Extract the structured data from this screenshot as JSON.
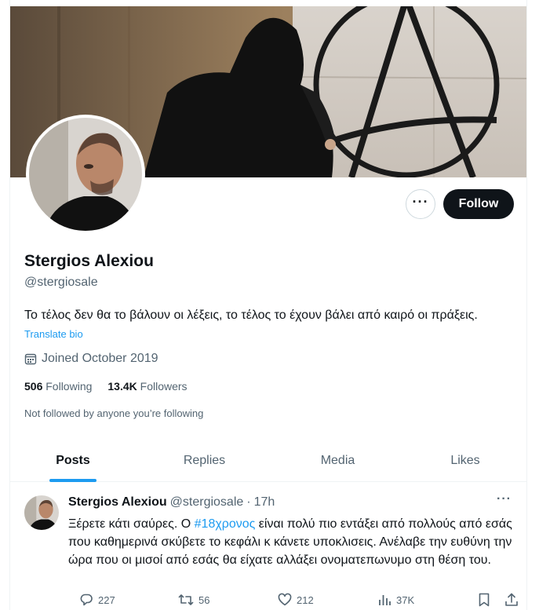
{
  "profile": {
    "name": "Stergios Alexiou",
    "handle": "@stergiosale",
    "bio": "Το τέλος δεν θα το βάλουν οι λέξεις, το τέλος το έχουν βάλει από καιρό οι πράξεις.",
    "translate_label": "Translate bio",
    "joined": "Joined October 2019",
    "following_count": "506",
    "following_label": "Following",
    "followers_count": "13.4K",
    "followers_label": "Followers",
    "not_followed_note": "Not followed by anyone you’re following"
  },
  "actions": {
    "more_label": "···",
    "follow_label": "Follow"
  },
  "tabs": [
    {
      "label": "Posts",
      "active": true
    },
    {
      "label": "Replies",
      "active": false
    },
    {
      "label": "Media",
      "active": false
    },
    {
      "label": "Likes",
      "active": false
    }
  ],
  "tweet": {
    "author_name": "Stergios Alexiou",
    "author_handle": "@stergiosale",
    "separator": "·",
    "time": "17h",
    "more_label": "···",
    "text_before": "Ξέρετε κάτι σαύρες. Ο ",
    "hashtag": "#18χρονος",
    "text_after": " είναι πολύ πιο εντάξει από πολλούς από εσάς που καθημερινά σκύβετε το κεφάλι κ κάνετε υποκλισεις. Ανέλαβε την ευθύνη την ώρα που οι μισοί από εσάς θα είχατε αλλάξει ονοματεπωνυμο στη θέση του.",
    "replies": "227",
    "reposts": "56",
    "likes": "212",
    "views": "37K"
  },
  "icons": {
    "calendar": "calendar-icon",
    "reply": "reply-icon",
    "repost": "repost-icon",
    "like": "heart-icon",
    "views": "views-icon",
    "bookmark": "bookmark-icon",
    "share": "share-icon"
  },
  "colors": {
    "accent": "#1d9bf0",
    "text": "#0f1419",
    "muted": "#536471",
    "follow_bg": "#0f1419"
  }
}
